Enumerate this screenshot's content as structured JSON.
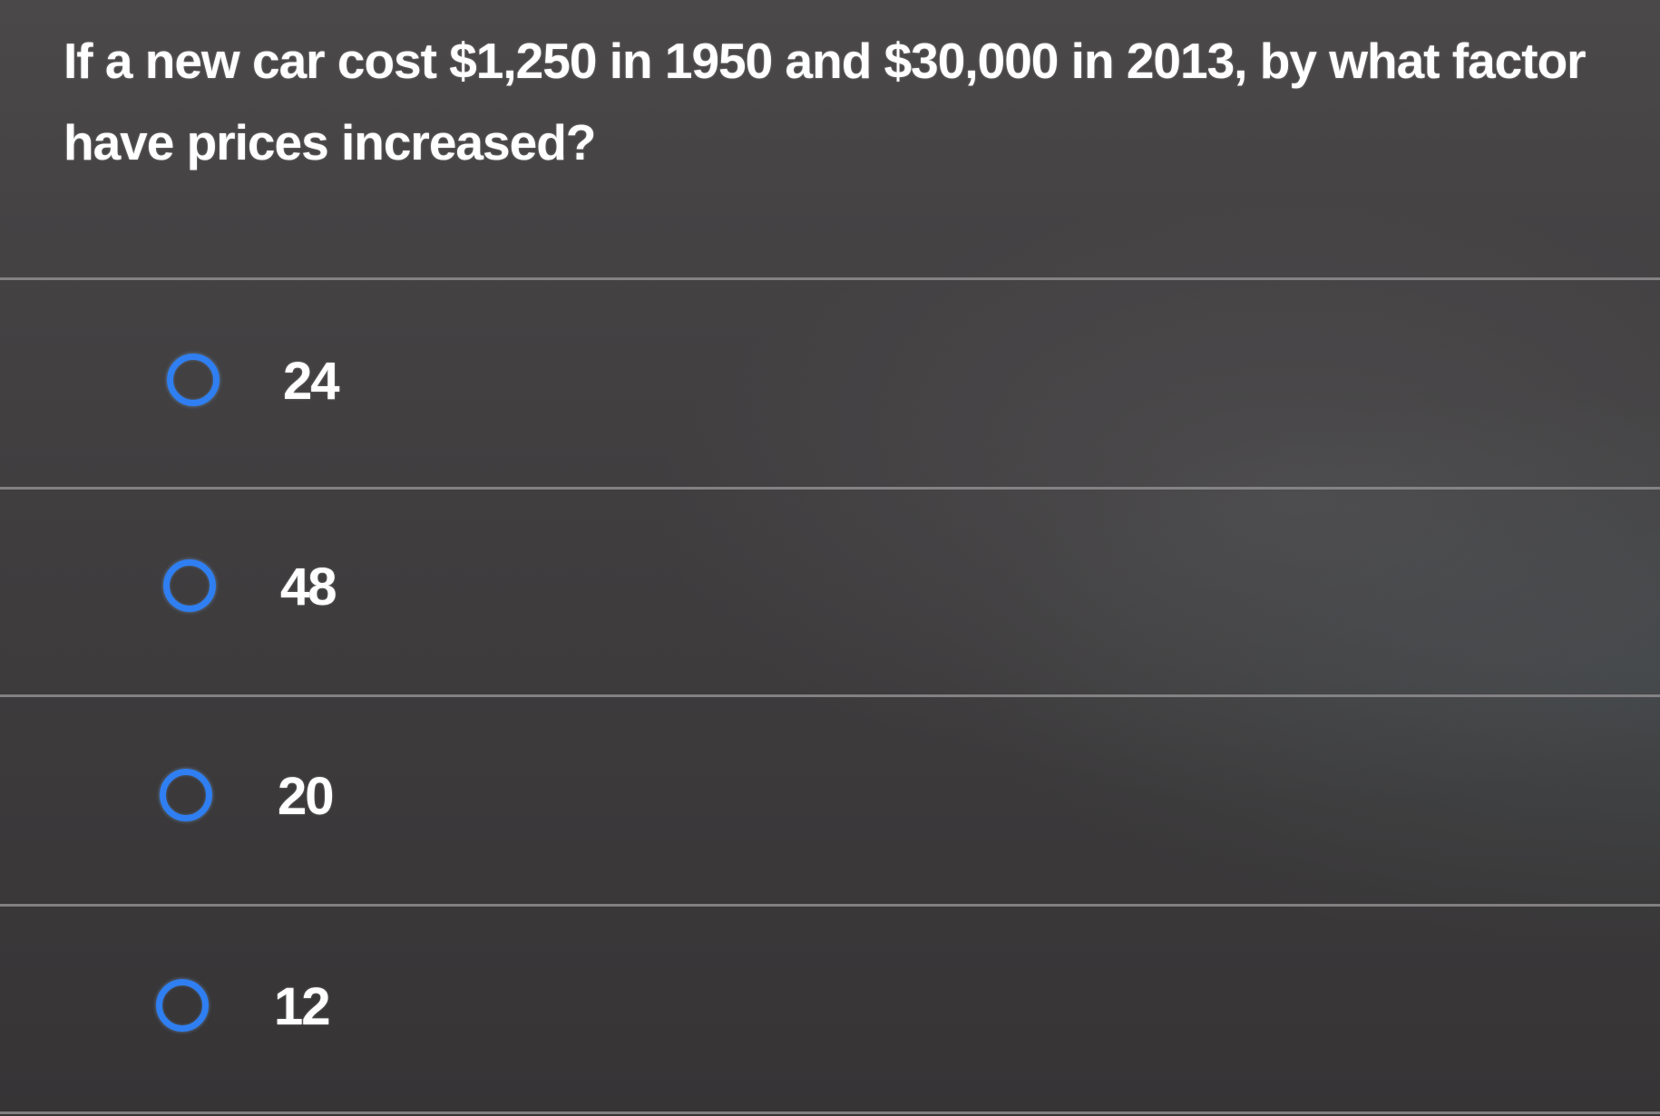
{
  "question": {
    "text": "If a new car cost $1,250 in 1950 and $30,000 in 2013, by what factor have prices increased?"
  },
  "options": [
    {
      "label": "24",
      "selected": false
    },
    {
      "label": "48",
      "selected": false
    },
    {
      "label": "20",
      "selected": false
    },
    {
      "label": "12",
      "selected": false
    }
  ],
  "colors": {
    "radio_accent": "#2f7ff2",
    "background": "#3f3d3e",
    "text": "#ffffff"
  }
}
